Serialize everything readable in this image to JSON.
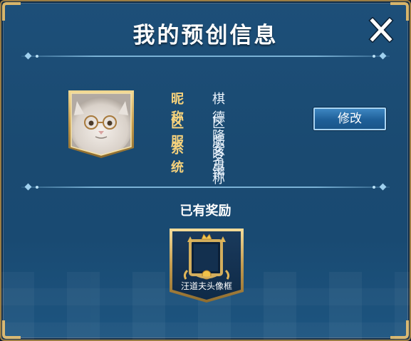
{
  "dialog": {
    "title": "我的预创信息",
    "close_label": "X"
  },
  "profile": {
    "avatar": "cat-with-glasses-photo",
    "rows": [
      {
        "label": "昵称",
        "value": "棋德隆咚锵"
      },
      {
        "label": "区服",
        "value": "区服名称"
      },
      {
        "label": "系统",
        "value": "安卓"
      }
    ],
    "edit_button": "修改"
  },
  "rewards": {
    "heading": "已有奖励",
    "items": [
      {
        "name": "汪道夫头像框",
        "icon": "avatar-frame-icon"
      }
    ]
  },
  "colors": {
    "panel_bg": "#1b4c74",
    "border_gold": "#d8b56a",
    "label_gold": "#f6d27c",
    "button_blue": "#1e5f98"
  }
}
